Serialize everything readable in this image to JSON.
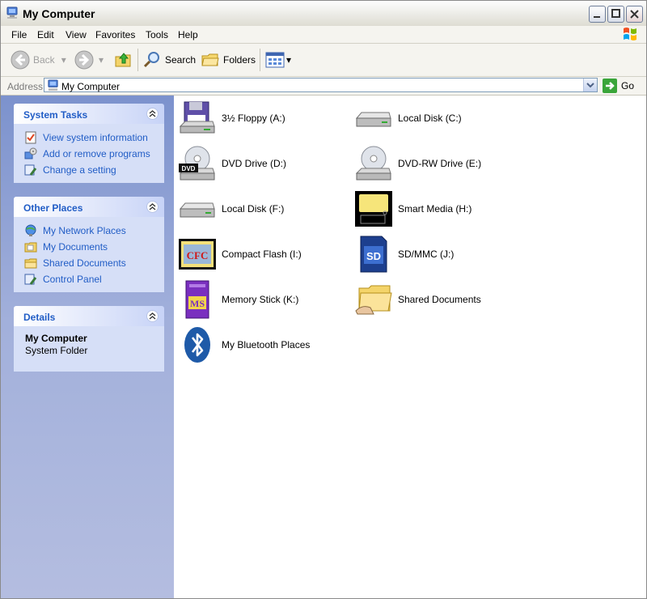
{
  "window": {
    "title": "My Computer"
  },
  "menu": [
    "File",
    "Edit",
    "View",
    "Favorites",
    "Tools",
    "Help"
  ],
  "toolbar": {
    "back": "Back",
    "search": "Search",
    "folders": "Folders"
  },
  "address": {
    "label": "Address",
    "value": "My Computer",
    "go": "Go"
  },
  "system_tasks": {
    "title": "System Tasks",
    "items": [
      "View system information",
      "Add or remove programs",
      "Change a setting"
    ]
  },
  "other_places": {
    "title": "Other Places",
    "items": [
      "My Network Places",
      "My Documents",
      "Shared Documents",
      "Control Panel"
    ]
  },
  "details": {
    "title": "Details",
    "name": "My Computer",
    "type": "System Folder"
  },
  "drives": [
    "3½ Floppy (A:)",
    "Local Disk (C:)",
    "DVD Drive (D:)",
    "DVD-RW Drive (E:)",
    "Local Disk (F:)",
    "Smart Media (H:)",
    "Compact Flash (I:)",
    "SD/MMC (J:)",
    "Memory Stick (K:)",
    "Shared Documents",
    "My Bluetooth Places"
  ],
  "icon_labels": {
    "dvd": "DVD",
    "cfc": "CFC",
    "sd": "SD",
    "ms": "MS"
  },
  "colors": {
    "link": "#215dc6",
    "sidebar": "#7c92cd",
    "panel_body": "#d6dff7"
  }
}
